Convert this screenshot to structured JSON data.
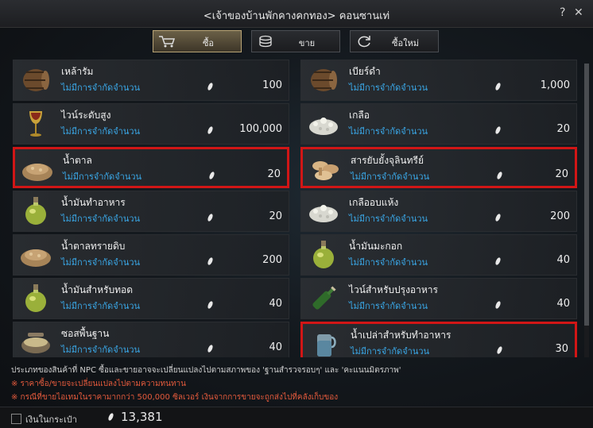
{
  "window": {
    "title": "<เจ้าของบ้านพักคางคกทอง> คอนซานเท่",
    "help_icon": "?",
    "close_icon": "✕"
  },
  "tabs": [
    {
      "label": "ซื้อ",
      "icon": "cart-icon",
      "active": true
    },
    {
      "label": "ขาย",
      "icon": "coins-icon",
      "active": false
    },
    {
      "label": "ซื้อใหม่",
      "icon": "refresh-icon",
      "active": false
    }
  ],
  "items": [
    {
      "name": "เหล้ารัม",
      "qty": "ไม่มีการจำกัดจำนวน",
      "price": "100",
      "icon": "barrel-icon",
      "highlighted": false
    },
    {
      "name": "เบียร์ดำ",
      "qty": "ไม่มีการจำกัดจำนวน",
      "price": "1,000",
      "icon": "barrel-icon",
      "highlighted": false
    },
    {
      "name": "ไวน์ระดับสูง",
      "qty": "ไม่มีการจำกัดจำนวน",
      "price": "100,000",
      "icon": "goblet-icon",
      "highlighted": false
    },
    {
      "name": "เกลือ",
      "qty": "ไม่มีการจำกัดจำนวน",
      "price": "20",
      "icon": "salt-icon",
      "highlighted": false
    },
    {
      "name": "น้ำตาล",
      "qty": "ไม่มีการจำกัดจำนวน",
      "price": "20",
      "icon": "sugar-icon",
      "highlighted": true
    },
    {
      "name": "สารยับยั้งจุลินทรีย์",
      "qty": "ไม่มีการจำกัดจำนวน",
      "price": "20",
      "icon": "mushroom-icon",
      "highlighted": true
    },
    {
      "name": "น้ำมันทำอาหาร",
      "qty": "ไม่มีการจำกัดจำนวน",
      "price": "20",
      "icon": "oil-flask-icon",
      "highlighted": false
    },
    {
      "name": "เกลืออบแห้ง",
      "qty": "ไม่มีการจำกัดจำนวน",
      "price": "200",
      "icon": "salt-icon",
      "highlighted": false
    },
    {
      "name": "น้ำตาลทรายดิบ",
      "qty": "ไม่มีการจำกัดจำนวน",
      "price": "200",
      "icon": "sugar-icon",
      "highlighted": false
    },
    {
      "name": "น้ำมันมะกอก",
      "qty": "ไม่มีการจำกัดจำนวน",
      "price": "40",
      "icon": "oil-flask-icon",
      "highlighted": false
    },
    {
      "name": "น้ำมันสำหรับทอด",
      "qty": "ไม่มีการจำกัดจำนวน",
      "price": "40",
      "icon": "oil-flask-icon",
      "highlighted": false
    },
    {
      "name": "ไวน์สำหรับปรุงอาหาร",
      "qty": "ไม่มีการจำกัดจำนวน",
      "price": "40",
      "icon": "wine-bottle-icon",
      "highlighted": false
    },
    {
      "name": "ซอสพื้นฐาน",
      "qty": "ไม่มีการจำกัดจำนวน",
      "price": "40",
      "icon": "sauce-bowl-icon",
      "highlighted": false
    },
    {
      "name": "น้ำเปล่าสำหรับทำอาหาร",
      "qty": "ไม่มีการจำกัดจำนวน",
      "price": "30",
      "icon": "water-jug-icon",
      "highlighted": true
    }
  ],
  "notes": {
    "line1": "ประเภทของสินค้าที่ NPC ซื้อและขายอาจจะเปลี่ยนแปลงไปตามสภาพของ 'ฐานสำรวจรอบๆ' และ 'คะแนนมิตรภาพ'",
    "line2": "※ ราคาซื้อ/ขายจะเปลี่ยนแปลงไปตามความทนทาน",
    "line3": "※ กรณีที่ขายไอเทมในราคามากกว่า 500,000 ซิลเวอร์ เงินจากการขายจะถูกส่งไปที่คลังเก็บของ"
  },
  "footer": {
    "label": "เงินในกระเป๋า",
    "amount": "13,381",
    "currency_icon": "silver-icon"
  }
}
